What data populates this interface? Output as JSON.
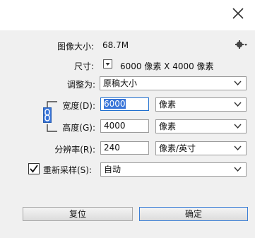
{
  "dialog": {
    "close_icon": "close-icon",
    "image_size_label": "图像大小:",
    "image_size_value": "68.7M",
    "settings_icon": "gear-icon",
    "dimensions_label": "尺寸:",
    "dimensions_value": "6000 像素  X  4000 像素",
    "fit_to": {
      "label": "调整为:",
      "value": "原稿大小"
    },
    "constrain_icon": "chain-link-icon",
    "width": {
      "label": "宽度(D):",
      "value": "6000",
      "unit": "像素"
    },
    "height": {
      "label": "高度(G):",
      "value": "4000",
      "unit": "像素"
    },
    "resolution": {
      "label": "分辨率(R):",
      "value": "240",
      "unit": "像素/英寸"
    },
    "resample": {
      "label": "重新采样(S):",
      "checked": true,
      "value": "自动"
    },
    "buttons": {
      "reset": "复位",
      "ok": "确定"
    }
  }
}
